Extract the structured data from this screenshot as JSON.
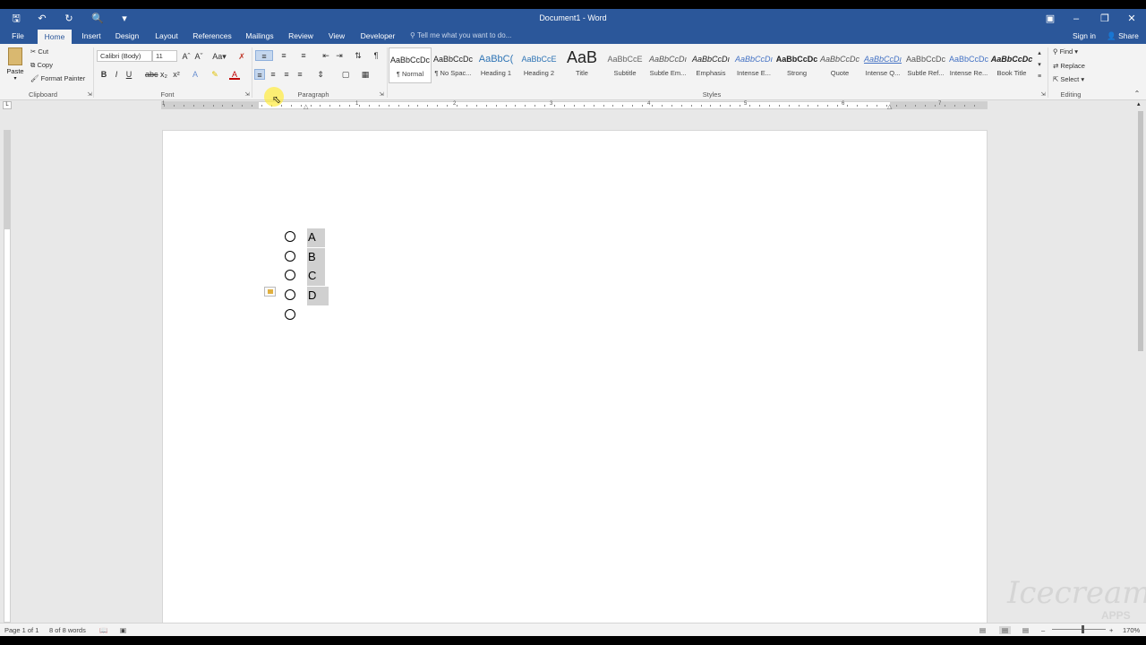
{
  "window": {
    "title": "Document1 - Word",
    "sign_in": "Sign in",
    "share": "Share"
  },
  "tabs": [
    "File",
    "Home",
    "Insert",
    "Design",
    "Layout",
    "References",
    "Mailings",
    "Review",
    "View",
    "Developer"
  ],
  "active_tab": "Home",
  "tell_me": "Tell me what you want to do...",
  "clipboard": {
    "paste": "Paste",
    "cut": "Cut",
    "copy": "Copy",
    "format_painter": "Format Painter",
    "label": "Clipboard"
  },
  "font": {
    "name": "Calibri (Body)",
    "size": "11",
    "label": "Font"
  },
  "paragraph": {
    "label": "Paragraph"
  },
  "styles": {
    "label": "Styles",
    "items": [
      {
        "preview": "AaBbCcDc",
        "name": "¶ Normal"
      },
      {
        "preview": "AaBbCcDc",
        "name": "¶ No Spac..."
      },
      {
        "preview": "AaBbC(",
        "name": "Heading 1"
      },
      {
        "preview": "AaBbCcE",
        "name": "Heading 2"
      },
      {
        "preview": "AaB",
        "name": "Title"
      },
      {
        "preview": "AaBbCcE",
        "name": "Subtitle"
      },
      {
        "preview": "AaBbCcDı",
        "name": "Subtle Em..."
      },
      {
        "preview": "AaBbCcDı",
        "name": "Emphasis"
      },
      {
        "preview": "AaBbCcDı",
        "name": "Intense E..."
      },
      {
        "preview": "AaBbCcDc",
        "name": "Strong"
      },
      {
        "preview": "AaBbCcDc",
        "name": "Quote"
      },
      {
        "preview": "AaBbCcDı",
        "name": "Intense Q..."
      },
      {
        "preview": "AaBbCcDc",
        "name": "Subtle Ref..."
      },
      {
        "preview": "AaBbCcDc",
        "name": "Intense Re..."
      },
      {
        "preview": "AaBbCcDc",
        "name": "Book Title"
      }
    ]
  },
  "editing": {
    "find": "Find",
    "replace": "Replace",
    "select": "Select",
    "label": "Editing"
  },
  "ruler_numbers": [
    "1",
    "1",
    "2",
    "3",
    "4",
    "5",
    "6",
    "7"
  ],
  "document": {
    "list_items": [
      "A",
      "B",
      "C",
      "D",
      ""
    ]
  },
  "status": {
    "page": "Page 1 of 1",
    "words": "8 of 8 words",
    "zoom": "170%"
  },
  "watermark": {
    "text": "Icecream",
    "sub": "APPS"
  }
}
